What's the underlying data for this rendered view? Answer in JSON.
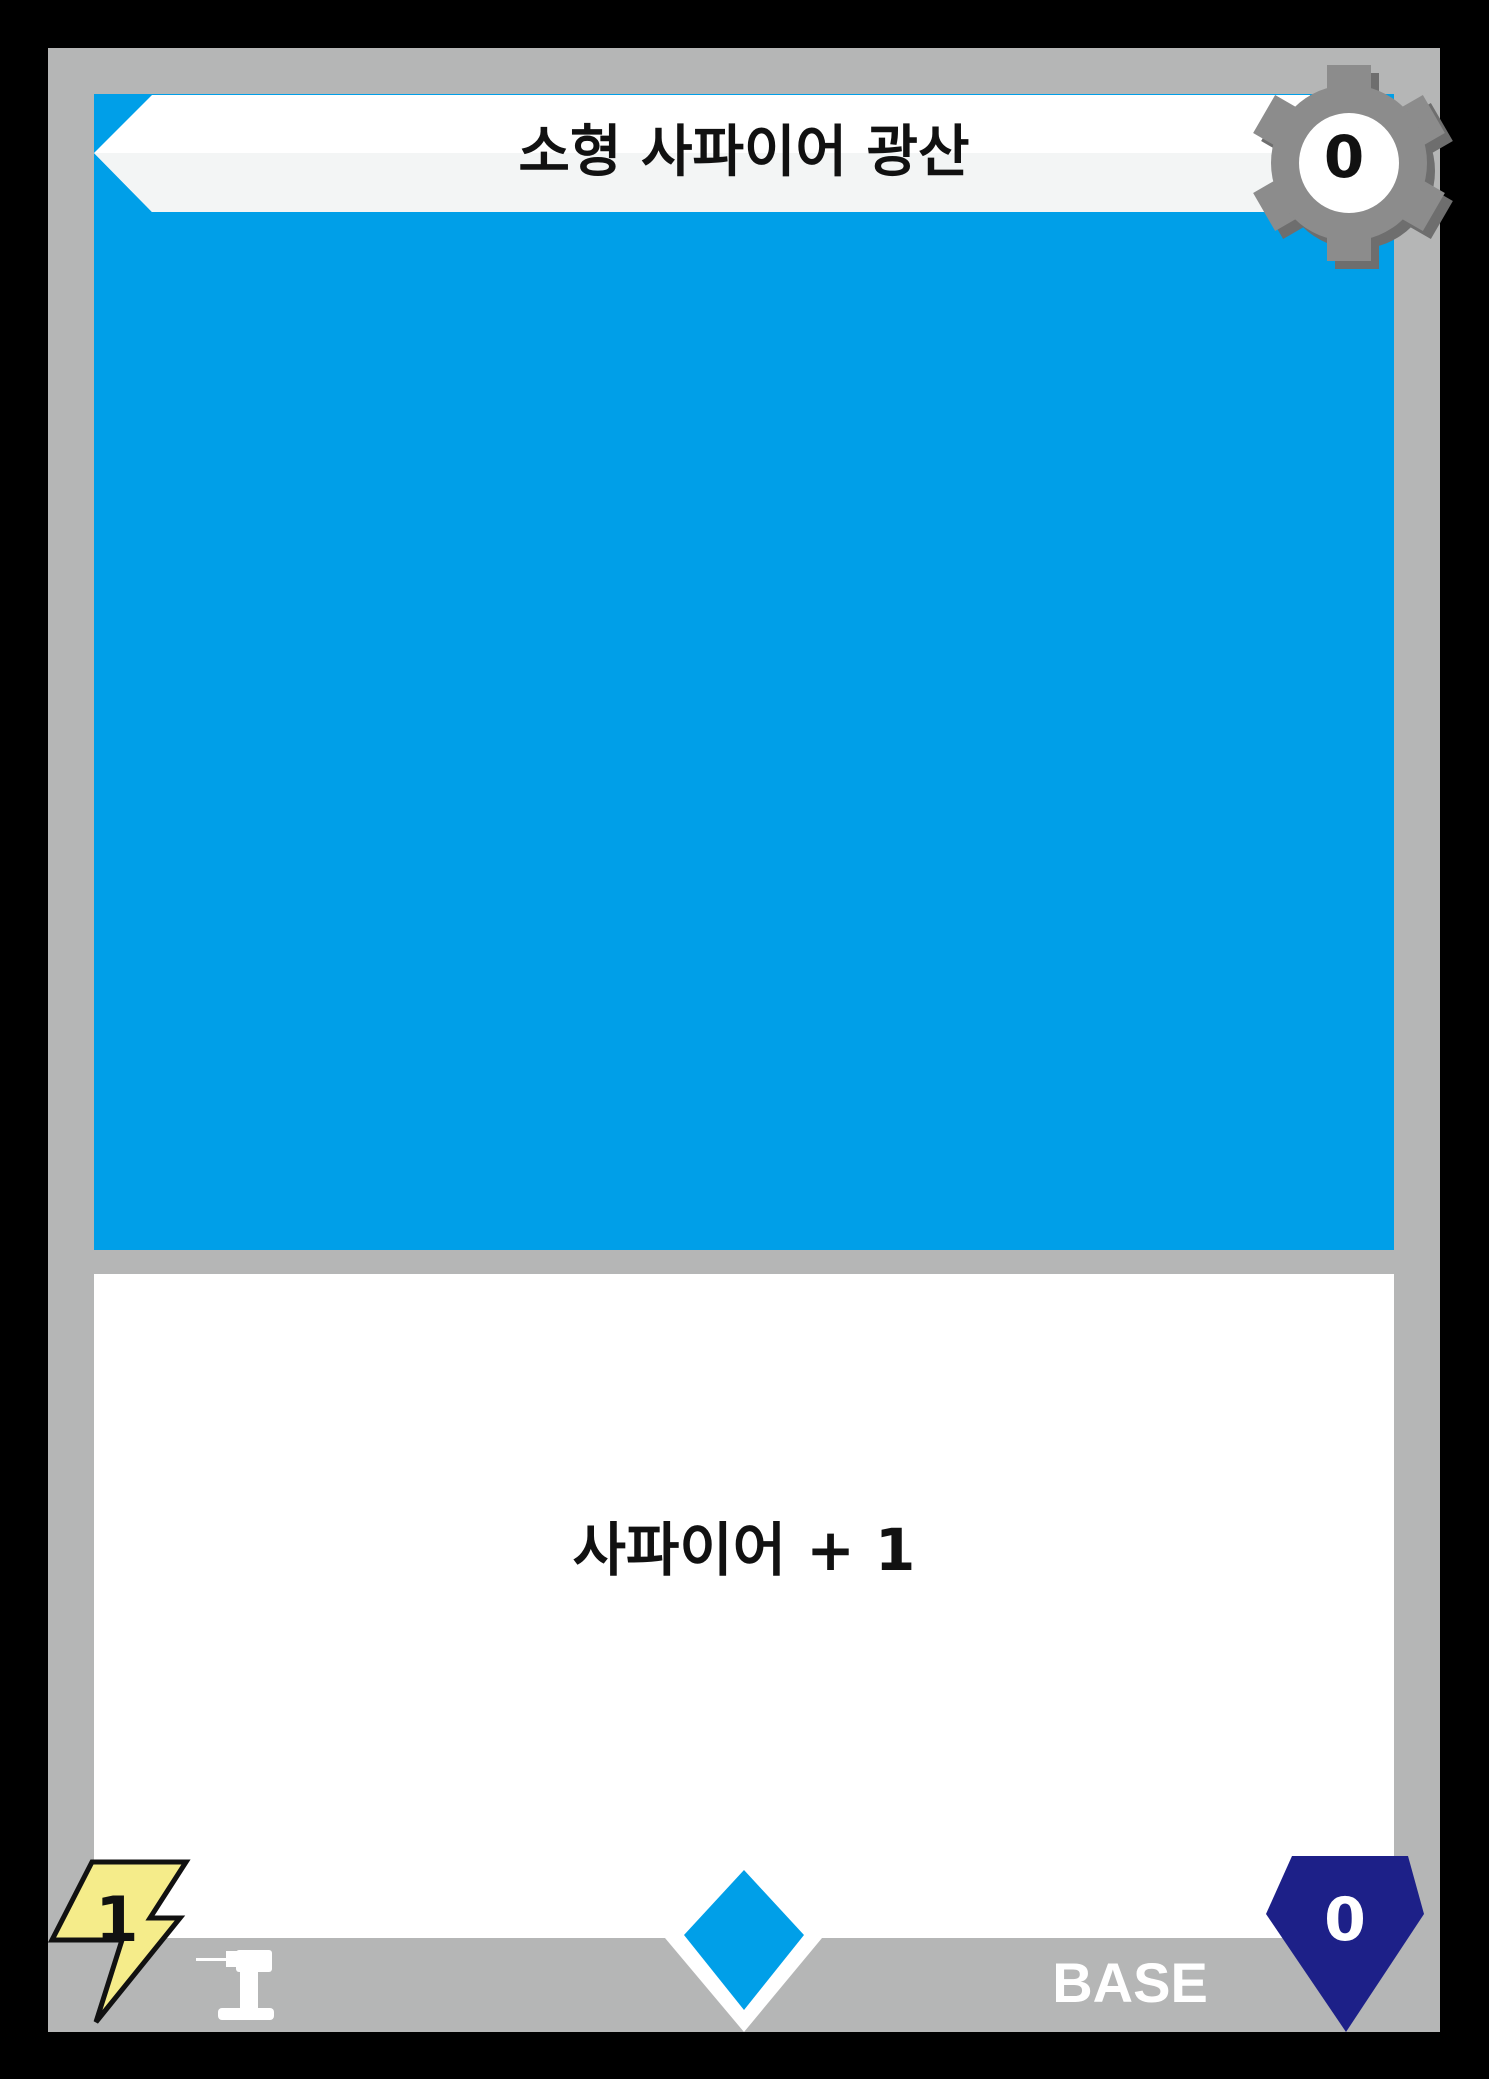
{
  "card": {
    "title": "소형 사파이어 광산",
    "gear_value": "0",
    "effect": "사파이어 + 1",
    "cost": "1",
    "type": "BASE",
    "gem_value": "0"
  },
  "icons": {
    "gear": "gear-icon",
    "cost": "lightning-bolt-icon",
    "tool": "drill-icon",
    "gem": "blue-diamond-icon",
    "badge": "pentagon-gem-badge-icon"
  },
  "colors": {
    "frame": "#b5b6b6",
    "art": "#009fe8",
    "gear": "#8c8c8c",
    "bolt": "#f5ec8a",
    "badge": "#1d2088",
    "diamond": "#009fe8"
  }
}
